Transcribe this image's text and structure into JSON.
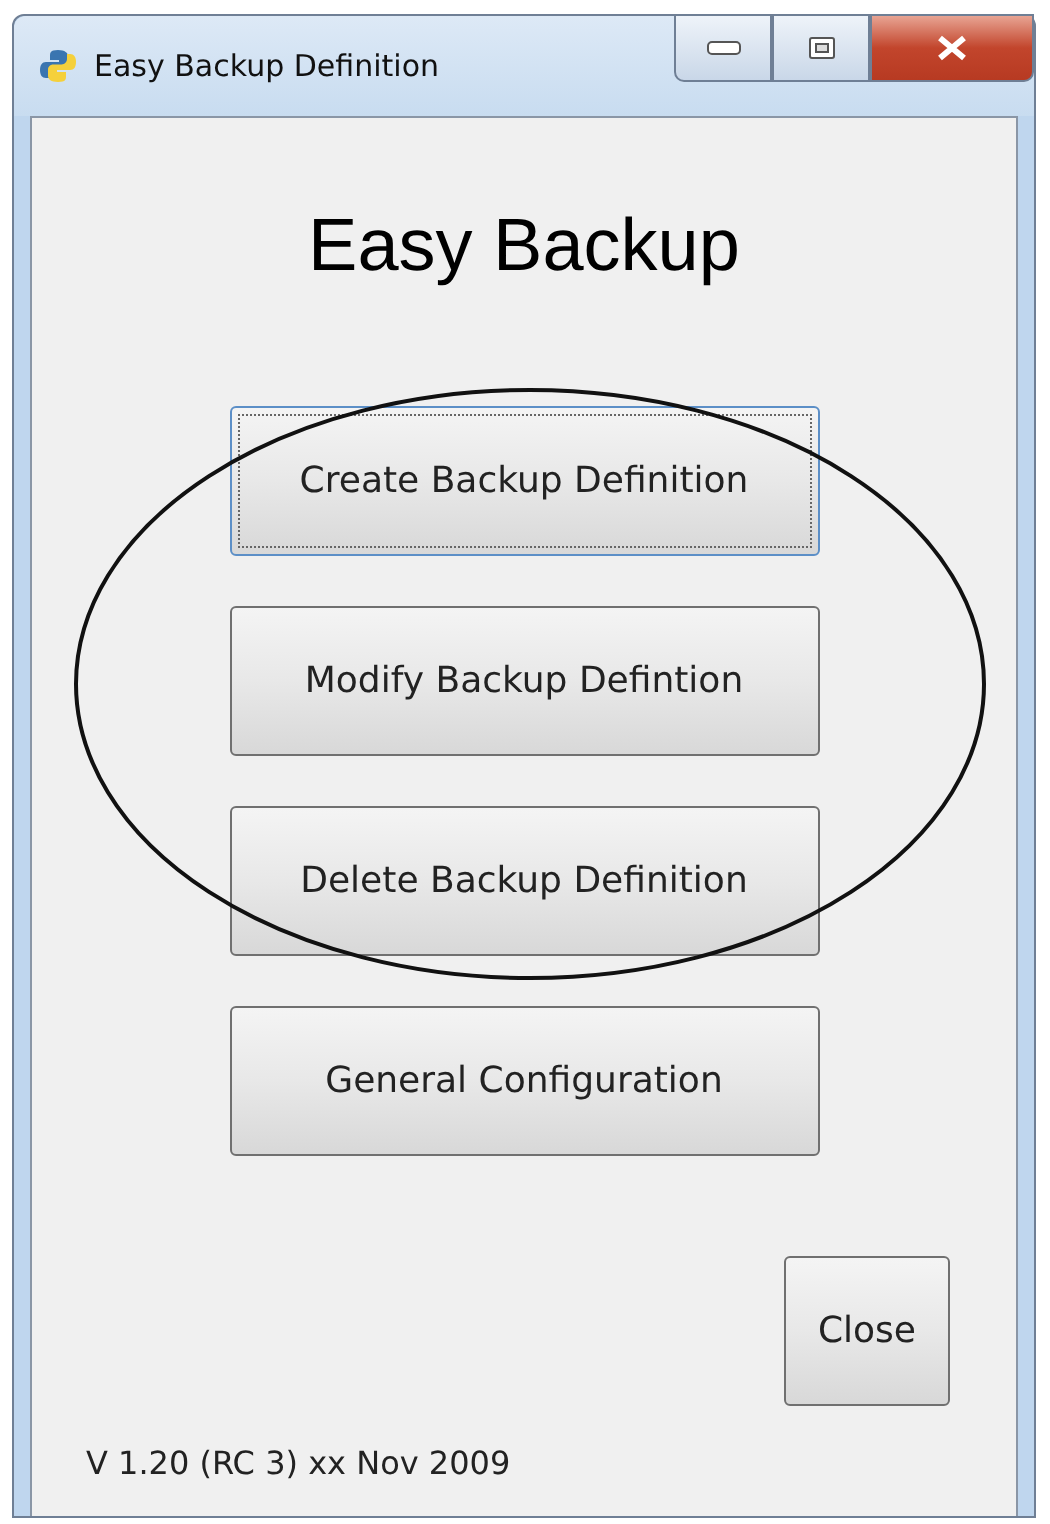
{
  "window": {
    "title": "Easy Backup Definition"
  },
  "heading": "Easy Backup",
  "buttons": [
    {
      "label": "Create Backup Definition",
      "focused": true
    },
    {
      "label": "Modify Backup Defintion",
      "focused": false
    },
    {
      "label": "Delete Backup Definition",
      "focused": false
    },
    {
      "label": "General Configuration",
      "focused": false
    }
  ],
  "close_button": {
    "label": "Close"
  },
  "version": "V 1.20 (RC 3)  xx Nov 2009",
  "annotation": {
    "kind": "ellipse"
  }
}
